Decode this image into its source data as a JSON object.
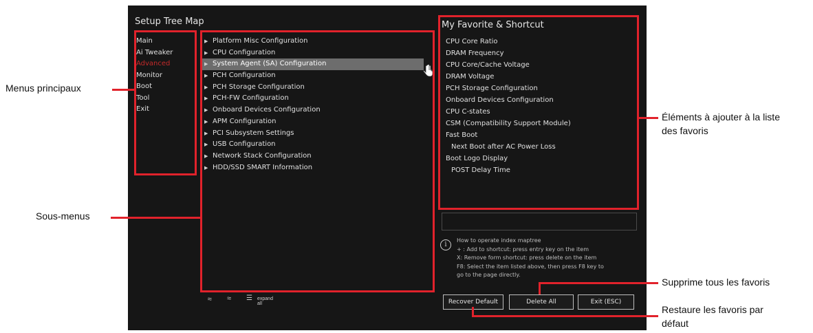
{
  "left_panel": {
    "title": "Setup Tree Map",
    "menu_items": [
      "Main",
      "Ai Tweaker",
      "Advanced",
      "Monitor",
      "Boot",
      "Tool",
      "Exit"
    ],
    "active_index": 2
  },
  "submenus": {
    "items": [
      "Platform Misc Configuration",
      "CPU Configuration",
      "System Agent (SA) Configuration",
      "PCH Configuration",
      "PCH Storage Configuration",
      "PCH-FW Configuration",
      "Onboard Devices Configuration",
      "APM Configuration",
      "PCI Subsystem Settings",
      "USB Configuration",
      "Network Stack Configuration",
      "HDD/SSD SMART Information"
    ],
    "selected_index": 2
  },
  "favorites": {
    "title": "My Favorite & Shortcut",
    "items": [
      "CPU Core Ratio",
      "DRAM Frequency",
      "CPU Core/Cache Voltage",
      "DRAM Voltage",
      "PCH Storage Configuration",
      "Onboard Devices Configuration",
      "CPU C-states",
      "CSM (Compatibility Support Module)",
      "Fast Boot",
      "Next Boot after AC Power Loss",
      "Boot Logo Display",
      "POST Delay Time"
    ],
    "indented": [
      9,
      11
    ]
  },
  "help": {
    "icon": "i",
    "lines": [
      "How to operate index maptree",
      "+ : Add to shortcut: press entry key on the item",
      "X: Remove form shortcut: press delete on the item",
      "F8: Select the item listed above, then press F8 key to",
      "go to the page directly."
    ]
  },
  "buttons": {
    "recover": "Recover Default",
    "delete_all": "Delete All",
    "exit": "Exit (ESC)"
  },
  "bottom_tools": {
    "up_icon": "≈",
    "down_icon": "≈",
    "expand_icon": "☰",
    "expand_label": "expand all"
  },
  "annotations": {
    "menus": "Menus principaux",
    "submenus": "Sous-menus",
    "favorites_line1": "Éléments à ajouter à la liste",
    "favorites_line2": "des favoris",
    "delete_all": "Supprime tous les favoris",
    "recover_line1": "Restaure les favoris par",
    "recover_line2": "défaut"
  },
  "colors": {
    "highlight_red": "#e1222b",
    "bios_background": "#161616",
    "selected_row": "#6d6d6d"
  }
}
